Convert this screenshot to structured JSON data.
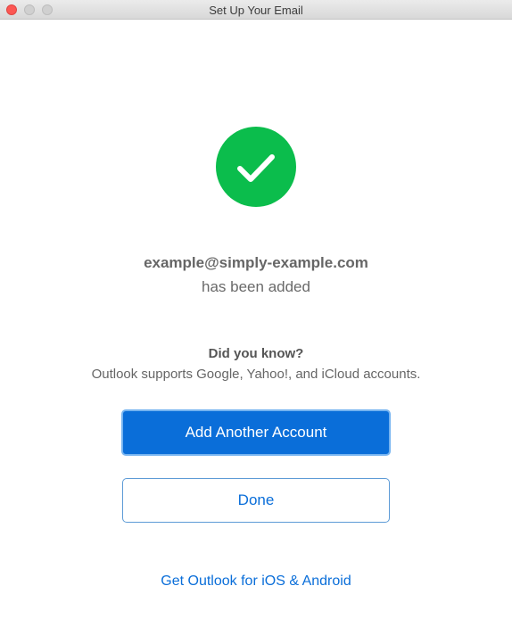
{
  "window": {
    "title": "Set Up Your Email"
  },
  "status": {
    "icon": "checkmark-icon",
    "color": "#0bbd4c",
    "email": "example@simply-example.com",
    "message": "has been added"
  },
  "tip": {
    "heading": "Did you know?",
    "text": "Outlook supports Google, Yahoo!, and iCloud accounts."
  },
  "actions": {
    "add_account_label": "Add Another Account",
    "done_label": "Done",
    "mobile_link_label": "Get Outlook for iOS & Android"
  },
  "colors": {
    "accent": "#0a6ed9",
    "success": "#0bbd4c"
  }
}
